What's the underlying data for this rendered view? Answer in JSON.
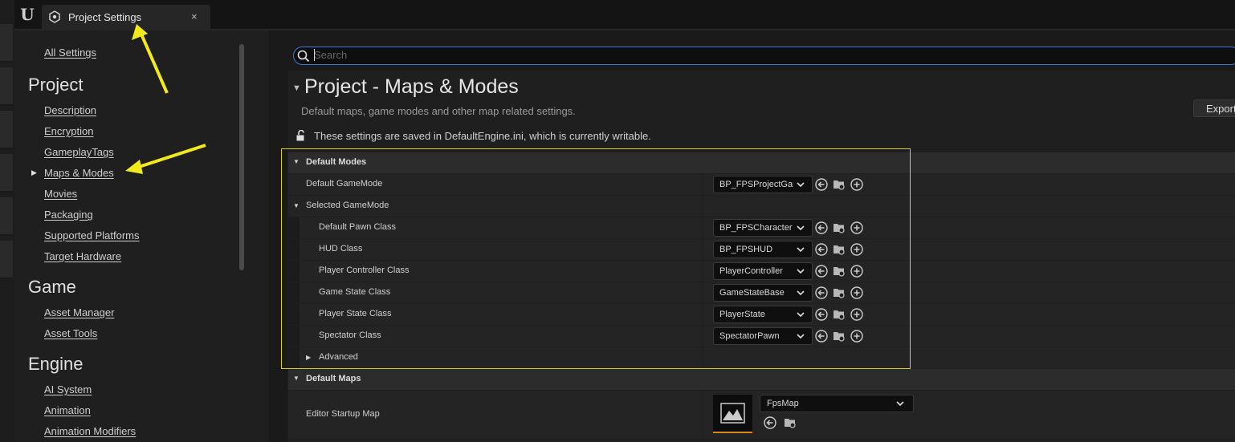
{
  "window": {
    "tab_title": "Project Settings",
    "close_glyph": "×",
    "logo_glyph": "U"
  },
  "sidebar": {
    "all_settings": "All Settings",
    "sections": [
      {
        "heading": "Project",
        "items": [
          "Description",
          "Encryption",
          "GameplayTags",
          "Maps & Modes",
          "Movies",
          "Packaging",
          "Supported Platforms",
          "Target Hardware"
        ]
      },
      {
        "heading": "Game",
        "items": [
          "Asset Manager",
          "Asset Tools"
        ]
      },
      {
        "heading": "Engine",
        "items": [
          "AI System",
          "Animation",
          "Animation Modifiers"
        ]
      }
    ],
    "selected": "Maps & Modes"
  },
  "search": {
    "placeholder": "Search"
  },
  "section": {
    "title": "Project - Maps & Modes",
    "description": "Default maps, game modes and other map related settings.",
    "export_label": "Export",
    "saved_note": "These settings are saved in DefaultEngine.ini, which is currently writable."
  },
  "default_modes": {
    "category": "Default Modes",
    "default_gamemode": {
      "label": "Default GameMode",
      "value": "BP_FPSProjectGameMode"
    },
    "selected_gamemode": "Selected GameMode",
    "classes": [
      {
        "label": "Default Pawn Class",
        "value": "BP_FPSCharacter"
      },
      {
        "label": "HUD Class",
        "value": "BP_FPSHUD"
      },
      {
        "label": "Player Controller Class",
        "value": "PlayerController"
      },
      {
        "label": "Game State Class",
        "value": "GameStateBase"
      },
      {
        "label": "Player State Class",
        "value": "PlayerState"
      },
      {
        "label": "Spectator Class",
        "value": "SpectatorPawn"
      }
    ],
    "advanced": "Advanced"
  },
  "default_maps": {
    "category": "Default Maps",
    "editor_startup_map": {
      "label": "Editor Startup Map",
      "value": "FpsMap"
    }
  },
  "colors": {
    "accent": "#3a7bd5",
    "highlight": "#d8d020",
    "annotation_arrow": "#f2ea1c"
  }
}
